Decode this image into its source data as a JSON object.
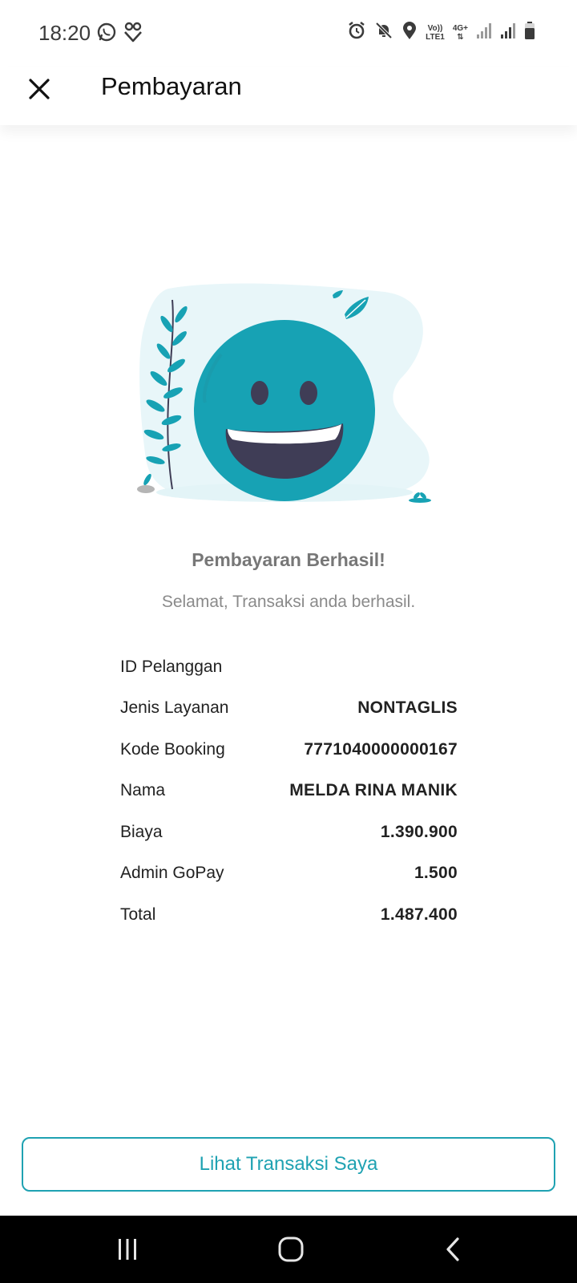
{
  "status_bar": {
    "time": "18:20",
    "left_icons": [
      "whatsapp-icon",
      "app-heart-icon"
    ],
    "right_icons": [
      "alarm-icon",
      "mute-icon",
      "location-icon",
      "volte-icon",
      "4g-icon",
      "signal-icon",
      "signal-icon",
      "battery-icon"
    ],
    "volte_label_top": "Vo))",
    "volte_label_bottom": "LTE1",
    "network_label": "4G+"
  },
  "app_bar": {
    "title": "Pembayaran",
    "close_icon": "close-icon"
  },
  "result": {
    "title": "Pembayaran Berhasil!",
    "subtitle": "Selamat, Transaksi anda berhasil."
  },
  "details": [
    {
      "label": "ID Pelanggan",
      "value": ""
    },
    {
      "label": "Jenis Layanan",
      "value": "NONTAGLIS"
    },
    {
      "label": "Kode Booking",
      "value": "7771040000000167"
    },
    {
      "label": "Nama",
      "value": "MELDA RINA MANIK"
    },
    {
      "label": "Biaya",
      "value": "1.390.900"
    },
    {
      "label": "Admin GoPay",
      "value": "1.500"
    },
    {
      "label": "Total",
      "value": "1.487.400"
    }
  ],
  "action_button": {
    "label": "Lihat Transaksi Saya"
  },
  "navigation": {
    "icons": [
      "recent-apps-icon",
      "home-icon",
      "back-icon"
    ]
  },
  "colors": {
    "accent": "#1fa2b2",
    "illustration_face": "#17a2b4",
    "illustration_mouth": "#3f3d56",
    "illustration_blob": "#e8f6f9"
  }
}
